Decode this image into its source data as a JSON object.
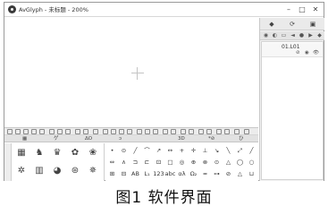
{
  "window": {
    "title": "AvGlyph - 未标题 - 200%",
    "minimize": "–",
    "maximize": "□",
    "close": "✕"
  },
  "right_panel": {
    "tabs": [
      "◆",
      "⟳",
      "▣"
    ],
    "tools": [
      "◉",
      "◐",
      "▭",
      "◄",
      "●",
      "▶",
      "◆"
    ],
    "layer": {
      "name": "01.L01",
      "icons": [
        "⊘",
        "◉",
        "👁"
      ]
    }
  },
  "palette_tabs": [
    "▦",
    "ゲ",
    "ΔO",
    "ↄ",
    "3D",
    "*⊘",
    "ひ"
  ],
  "gallery": [
    [
      "▦",
      "♞",
      "♛",
      "✿",
      "❀"
    ],
    [
      "✲",
      "▥",
      "◕",
      "⊛",
      "✵"
    ]
  ],
  "tools": [
    [
      "•",
      "⊙",
      "╱",
      "⌒",
      "↗",
      "↔",
      "+",
      "✛",
      "⊥",
      "↘",
      "╲",
      "⤢",
      "╱"
    ],
    [
      "⇔",
      "∧",
      "⊐",
      "⊏",
      "⊡",
      "□",
      "◎",
      "⊕",
      "⊗",
      "⊙",
      "△",
      "◯",
      "○"
    ],
    [
      "⊞",
      "⊟",
      "AB",
      "L₁",
      "123",
      "abc",
      "αλ",
      "Ω₂",
      "≈",
      "⊶",
      "⊘",
      "△",
      "⊔"
    ]
  ],
  "caption": "图1  软件界面",
  "colors": {
    "border": "#9a9a9a",
    "panel_bg": "#f2f2f2",
    "toolbar_bg": "#ececec"
  }
}
